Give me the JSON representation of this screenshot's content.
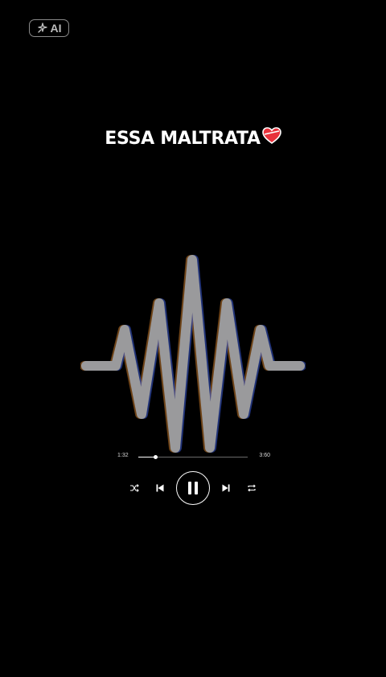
{
  "badge": {
    "label": "AI",
    "icon": "sparkle-wand-icon"
  },
  "track": {
    "title": "ESSA MALTRATA",
    "title_icon": "heart-icon"
  },
  "player": {
    "elapsed": "1:32",
    "total": "3:60",
    "progress": 0.16,
    "state": "playing",
    "controls": {
      "shuffle_icon": "shuffle-icon",
      "previous_icon": "skip-previous-icon",
      "pause_icon": "pause-icon",
      "next_icon": "skip-next-icon",
      "repeat_icon": "repeat-icon"
    }
  },
  "colors": {
    "background": "#000000",
    "waveform": "#9a9a9c",
    "heart": "#e8323c",
    "text": "#ffffff"
  }
}
